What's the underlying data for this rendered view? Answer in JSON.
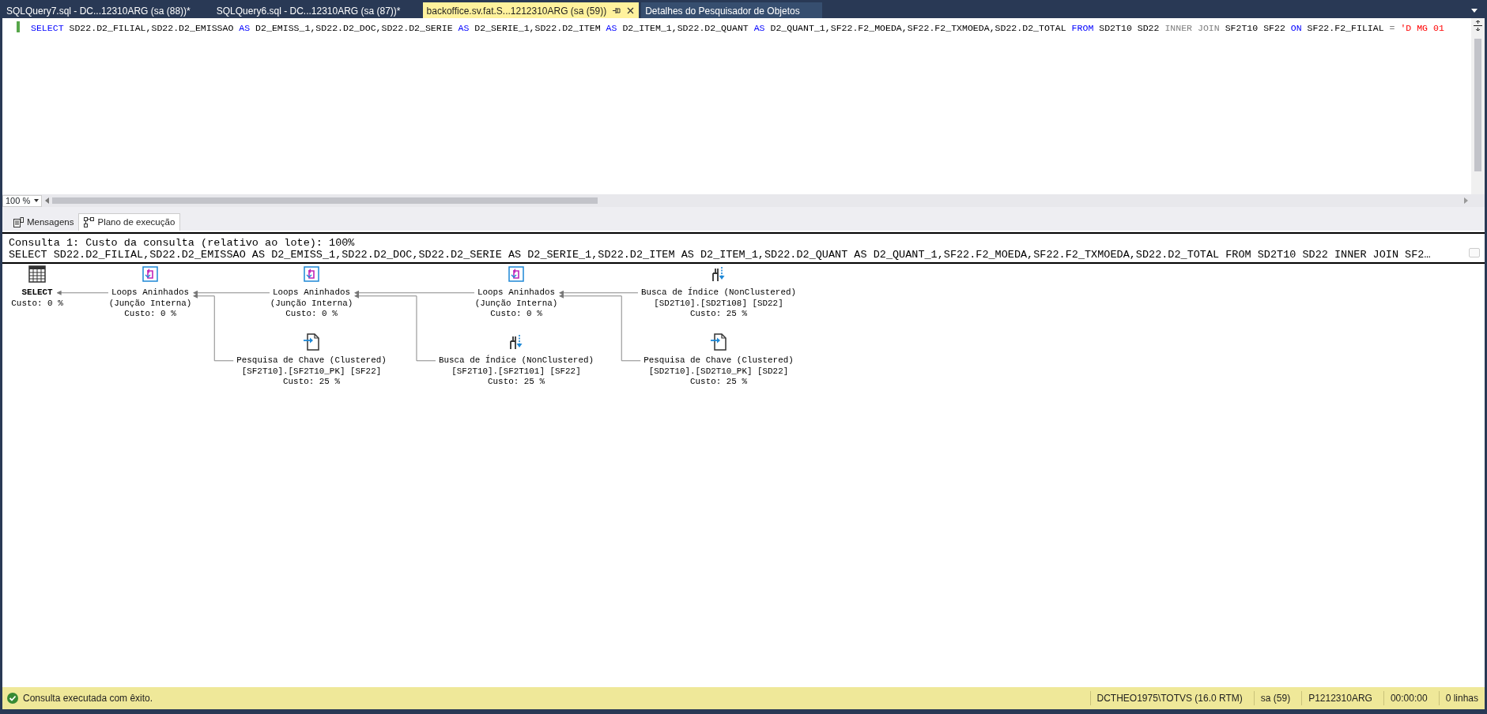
{
  "document_tabs": [
    {
      "label": "SQLQuery7.sql - DC...12310ARG (sa (88))*",
      "selected": false
    },
    {
      "label": "SQLQuery6.sql - DC...12310ARG (sa (87))*",
      "selected": false
    },
    {
      "label": "backoffice.sv.fat.S...1212310ARG (sa (59))",
      "selected": true
    },
    {
      "label": "Detalhes do Pesquisador de Objetos",
      "selected": false
    }
  ],
  "editor": {
    "line": [
      {
        "text": "SELECT",
        "kind": "keyword"
      },
      {
        "text": " SD22.D2_FILIAL,SD22.D2_EMISSAO ",
        "kind": "plain"
      },
      {
        "text": "AS",
        "kind": "keyword"
      },
      {
        "text": " D2_EMISS_1,SD22.D2_DOC,SD22.D2_SERIE ",
        "kind": "plain"
      },
      {
        "text": "AS",
        "kind": "keyword"
      },
      {
        "text": " D2_SERIE_1,SD22.D2_ITEM ",
        "kind": "plain"
      },
      {
        "text": "AS",
        "kind": "keyword"
      },
      {
        "text": " D2_ITEM_1,SD22.D2_QUANT ",
        "kind": "plain"
      },
      {
        "text": "AS",
        "kind": "keyword"
      },
      {
        "text": " D2_QUANT_1,SF22.F2_MOEDA,SF22.F2_TXMOEDA,SD22.D2_TOTAL ",
        "kind": "plain"
      },
      {
        "text": "FROM",
        "kind": "keyword"
      },
      {
        "text": " SD2T10 SD22 ",
        "kind": "plain"
      },
      {
        "text": "INNER JOIN",
        "kind": "operator"
      },
      {
        "text": " SF2T10 SF22 ",
        "kind": "plain"
      },
      {
        "text": "ON",
        "kind": "keyword"
      },
      {
        "text": " SF22.F2_FILIAL ",
        "kind": "plain"
      },
      {
        "text": "=",
        "kind": "operator"
      },
      {
        "text": " 'D MG 01",
        "kind": "string"
      }
    ]
  },
  "zoom": {
    "value": "100 %"
  },
  "result_tabs": [
    {
      "label": "Mensagens",
      "kind": "messages",
      "selected": false
    },
    {
      "label": "Plano de execução",
      "kind": "plan",
      "selected": true
    }
  ],
  "plan": {
    "header": "Consulta 1: Custo da consulta (relativo ao lote): 100%",
    "query": "SELECT SD22.D2_FILIAL,SD22.D2_EMISSAO AS D2_EMISS_1,SD22.D2_DOC,SD22.D2_SERIE AS D2_SERIE_1,SD22.D2_ITEM AS D2_ITEM_1,SD22.D2_QUANT AS D2_QUANT_1,SF22.F2_MOEDA,SF22.F2_TXMOEDA,SD22.D2_TOTAL FROM SD2T10 SD22 INNER JOIN SF2…",
    "root": {
      "kind": "select",
      "name": "SELECT",
      "cost": "Custo: 0 %",
      "children": [
        {
          "kind": "nested_loops",
          "name": "Loops Aninhados",
          "detail": "(Junção Interna)",
          "cost": "Custo: 0 %",
          "children": [
            {
              "kind": "nested_loops",
              "name": "Loops Aninhados",
              "detail": "(Junção Interna)",
              "cost": "Custo: 0 %",
              "children": [
                {
                  "kind": "nested_loops",
                  "name": "Loops Aninhados",
                  "detail": "(Junção Interna)",
                  "cost": "Custo: 0 %",
                  "children": [
                    {
                      "kind": "index_seek",
                      "name": "Busca de Índice (NonClustered)",
                      "detail": "[SD2T10].[SD2T108] [SD22]",
                      "cost": "Custo: 25 %"
                    },
                    {
                      "kind": "key_lookup",
                      "name": "Pesquisa de Chave (Clustered)",
                      "detail": "[SD2T10].[SD2T10_PK] [SD22]",
                      "cost": "Custo: 25 %"
                    }
                  ]
                },
                {
                  "kind": "index_seek",
                  "name": "Busca de Índice (NonClustered)",
                  "detail": "[SF2T10].[SF2T101] [SF22]",
                  "cost": "Custo: 25 %"
                }
              ]
            },
            {
              "kind": "key_lookup",
              "name": "Pesquisa de Chave (Clustered)",
              "detail": "[SF2T10].[SF2T10_PK] [SF22]",
              "cost": "Custo: 25 %"
            }
          ]
        }
      ]
    }
  },
  "status_bar": {
    "message": "Consulta executada com êxito.",
    "succeeded": true,
    "items": [
      "DCTHEO1975\\TOTVS (16.0 RTM)",
      "sa (59)",
      "P1212310ARG",
      "00:00:00",
      "0 linhas"
    ]
  }
}
